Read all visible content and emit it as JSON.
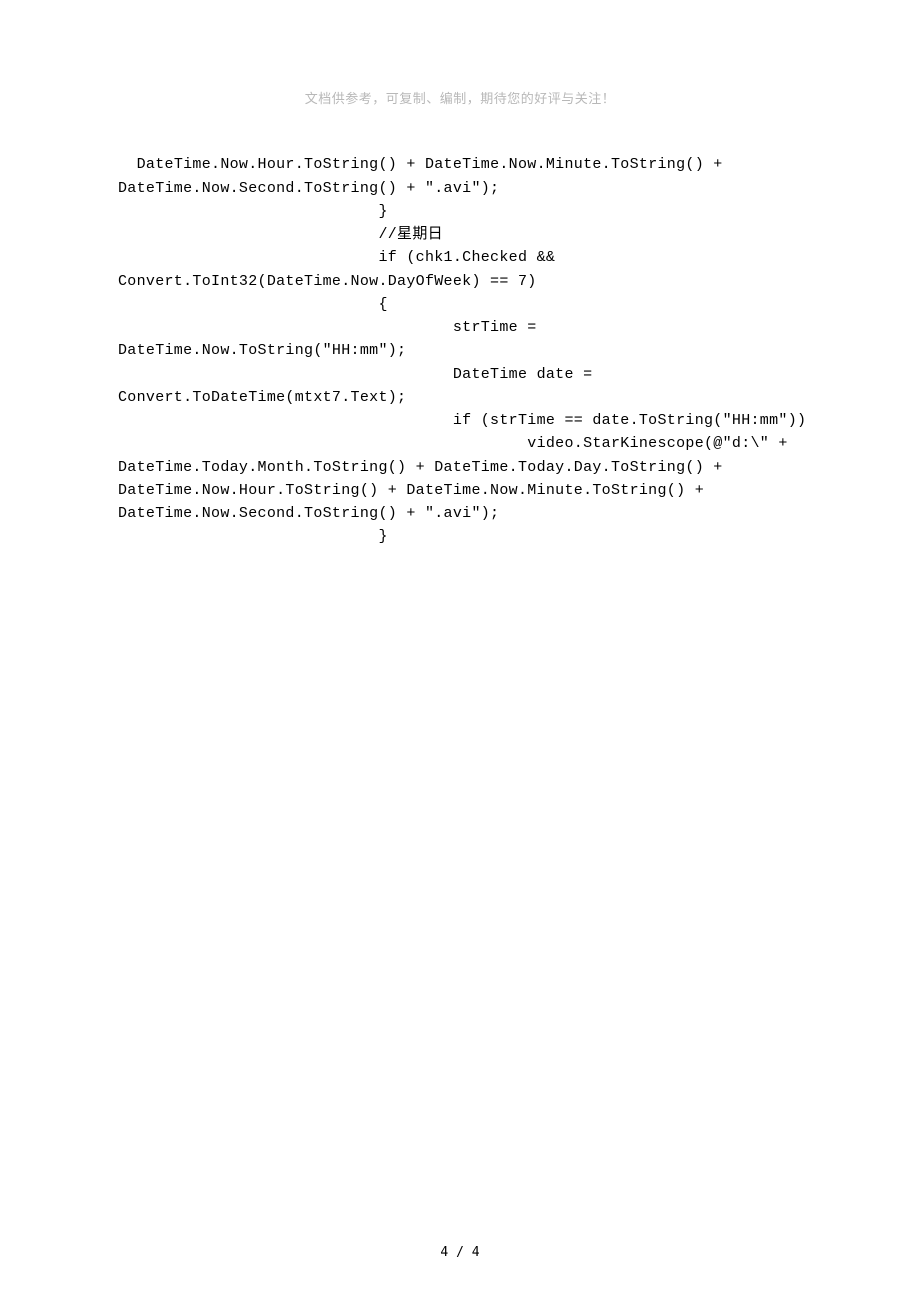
{
  "header": {
    "text": "文档供参考，可复制、编制，期待您的好评与关注！"
  },
  "content": {
    "code": "DateTime.Now.Hour.ToString() + DateTime.Now.Minute.ToString() + \nDateTime.Now.Second.ToString() + \".avi\");\n                            }\n                            //星期日\n                            if (chk1.Checked && \nConvert.ToInt32(DateTime.Now.DayOfWeek) == 7)\n                            {\n                                    strTime = \nDateTime.Now.ToString(\"HH:mm\");\n                                    DateTime date = \nConvert.ToDateTime(mtxt7.Text);\n                                    if (strTime == date.ToString(\"HH:mm\"))\n                                            video.StarKinescope(@\"d:\\\" + \nDateTime.Today.Month.ToString() + DateTime.Today.Day.ToString() + \nDateTime.Now.Hour.ToString() + DateTime.Now.Minute.ToString() + \nDateTime.Now.Second.ToString() + \".avi\");\n                            }"
  },
  "footer": {
    "text": "4 / 4"
  }
}
